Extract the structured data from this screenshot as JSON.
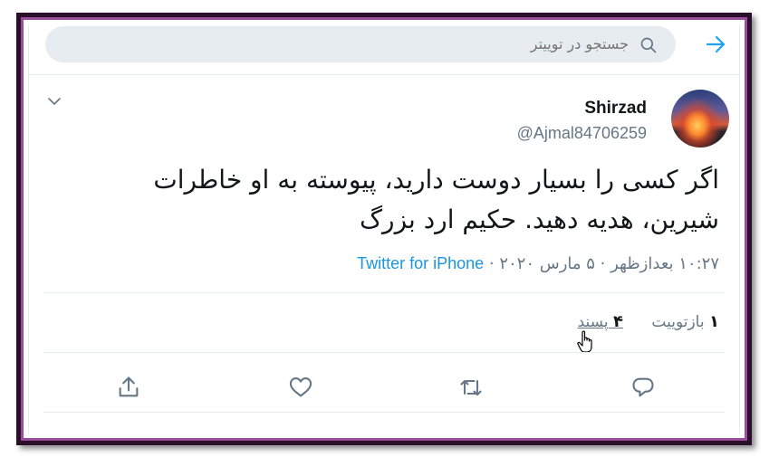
{
  "search": {
    "placeholder": "جستجو در توییتر"
  },
  "tweet": {
    "display_name": "Shirzad",
    "handle": "@Ajmal84706259",
    "text": "اگر کسی را بسیار دوست دارید، پیوسته به او خاطرات شیرین، هدیه دهید. حکیم ارد بزرگ",
    "time": "۱۰:۲۷ بعدازظهر",
    "date": "۵ مارس ۲۰۲۰",
    "separator": "·",
    "source": "Twitter for iPhone"
  },
  "stats": {
    "retweet_count": "۱",
    "retweet_label": "بازتوییت",
    "like_count": "۴",
    "like_label": "پسند"
  },
  "icons": {
    "back": "arrow-right-icon",
    "search": "search-icon",
    "more": "chevron-down-icon",
    "reply": "reply-icon",
    "retweet": "retweet-icon",
    "like": "heart-icon",
    "share": "share-icon"
  },
  "colors": {
    "accent": "#1da1f2",
    "link": "#1b95e0",
    "secondary_text": "#657786",
    "primary_text": "#14171a",
    "search_bg": "#e6ecf0",
    "frame": "#2a0f2a"
  }
}
